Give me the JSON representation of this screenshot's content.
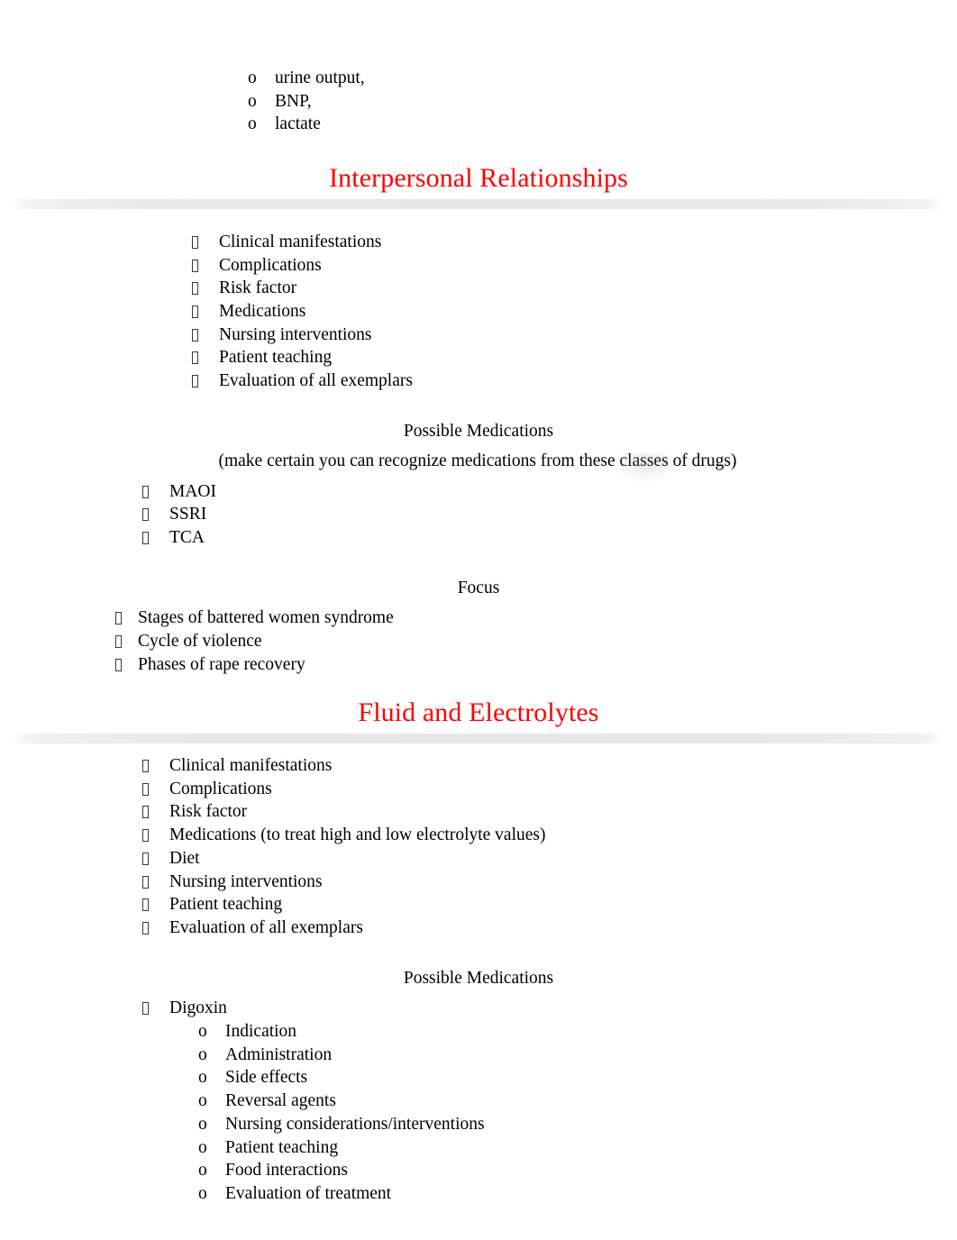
{
  "document": {
    "accent_red": "#FF0000",
    "text_color": "#000000",
    "bullet_glyph": "tofu-box",
    "sub_bullet_glyph": "o"
  },
  "top_list": {
    "items": [
      {
        "label": "urine output,"
      },
      {
        "label": "BNP,"
      },
      {
        "label": "lactate"
      }
    ]
  },
  "section_one": {
    "heading": "Interpersonal Relationships",
    "exemplar_list": {
      "items": [
        {
          "label": "Clinical manifestations"
        },
        {
          "label": "Complications"
        },
        {
          "label": "Risk factor"
        },
        {
          "label": "Medications"
        },
        {
          "label": "Nursing interventions"
        },
        {
          "label": "Patient teaching"
        },
        {
          "label": "Evaluation of all exemplars"
        }
      ]
    },
    "medications": {
      "title": "Possible Medications",
      "subtitle_before": "(make certain you can recognize medications from these ",
      "subtitle_highlight": "classes",
      "subtitle_after": "  of drugs)",
      "items": [
        {
          "label": "MAOI"
        },
        {
          "label": "SSRI"
        },
        {
          "label": "TCA"
        }
      ]
    },
    "focus": {
      "title": "Focus",
      "items": [
        {
          "label": "Stages of battered women syndrome"
        },
        {
          "label": "Cycle of violence"
        },
        {
          "label": "Phases of rape recovery"
        }
      ]
    }
  },
  "section_two": {
    "heading": "Fluid and Electrolytes",
    "exemplar_list": {
      "items": [
        {
          "label": "Clinical manifestations"
        },
        {
          "label": "Complications"
        },
        {
          "label": "Risk factor"
        },
        {
          "label": "Medications (to treat high and low electrolyte values)"
        },
        {
          "label": "Diet"
        },
        {
          "label": "Nursing interventions"
        },
        {
          "label": "Patient teaching"
        },
        {
          "label": "Evaluation of all exemplars"
        }
      ]
    },
    "medications": {
      "title": "Possible Medications",
      "drug": "Digoxin",
      "details": [
        {
          "label": "Indication"
        },
        {
          "label": "Administration"
        },
        {
          "label": "Side effects"
        },
        {
          "label": "Reversal agents"
        },
        {
          "label": "Nursing considerations/interventions"
        },
        {
          "label": "Patient teaching"
        },
        {
          "label": "Food interactions"
        },
        {
          "label": "Evaluation of treatment"
        }
      ]
    }
  }
}
